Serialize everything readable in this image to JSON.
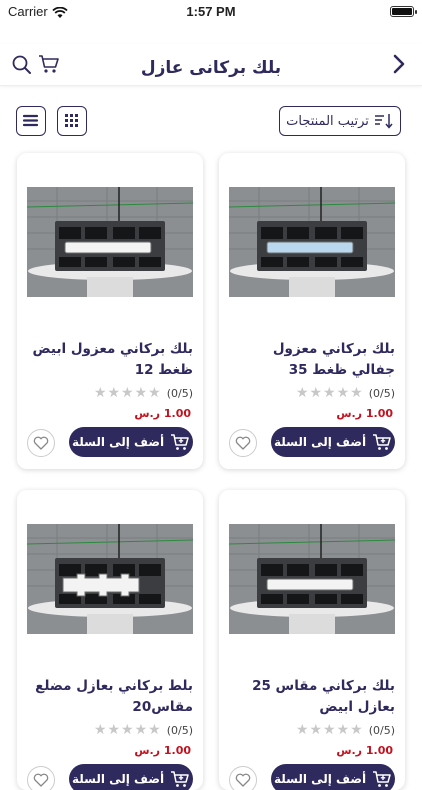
{
  "status_bar": {
    "carrier": "Carrier",
    "time": "1:57 PM"
  },
  "nav": {
    "title": "بلك بركانى عازل"
  },
  "toolbar": {
    "sort_label": "ترتيب المنتجات"
  },
  "colors": {
    "brand": "#2f2a5e",
    "price": "#c1121f",
    "star_empty": "#c8c8c8"
  },
  "products": [
    {
      "name": "بلك بركاني معزول جفالي ظغط 35",
      "rating": "(0/5)",
      "stars": "★★★★★",
      "price": "1.00 ر.س",
      "add_label": "أضف إلى السلة",
      "insert": "blue"
    },
    {
      "name": "بلك بركاني معزول ابيض ظغط 12",
      "rating": "(0/5)",
      "stars": "★★★★★",
      "price": "1.00 ر.س",
      "add_label": "أضف إلى السلة",
      "insert": "white"
    },
    {
      "name": "بلك بركاني مقاس 25 بعازل ابيض",
      "rating": "(0/5)",
      "stars": "★★★★★",
      "price": "1.00 ر.س",
      "add_label": "أضف إلى السلة",
      "insert": "white"
    },
    {
      "name": "بلط بركاني بعازل مضلع مقاس20",
      "rating": "(0/5)",
      "stars": "★★★★★",
      "price": "1.00 ر.س",
      "add_label": "أضف إلى السلة",
      "insert": "puzzle"
    }
  ]
}
